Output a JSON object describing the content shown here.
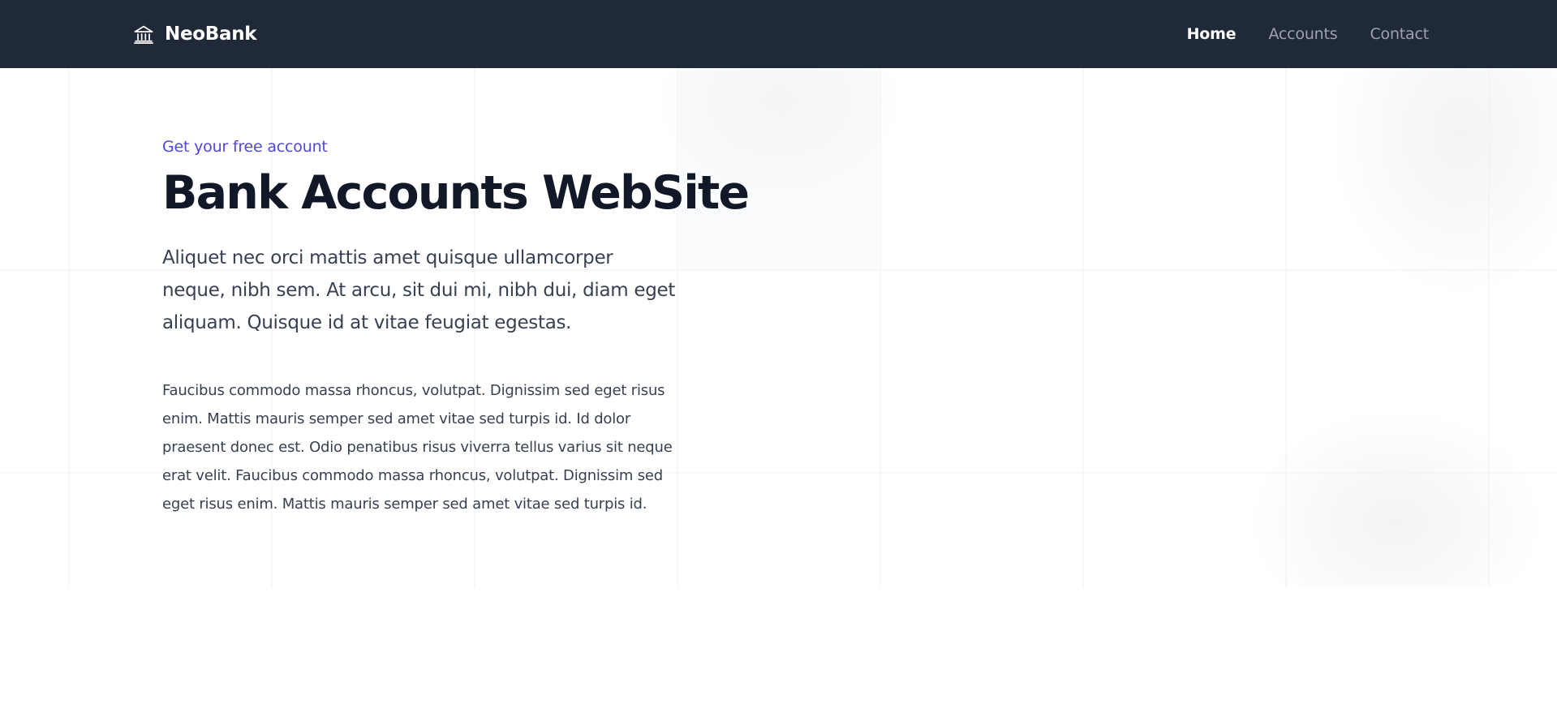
{
  "navbar": {
    "brand_icon": "bank-icon",
    "brand_name": "NeoBank",
    "links": [
      {
        "label": "Home",
        "active": true
      },
      {
        "label": "Accounts",
        "active": false
      },
      {
        "label": "Contact",
        "active": false
      }
    ]
  },
  "hero": {
    "eyebrow": "Get your free account",
    "title": "Bank Accounts WebSite",
    "lead": "Aliquet nec orci mattis amet quisque ullamcorper neque, nibh sem. At arcu, sit dui mi, nibh dui, diam eget aliquam. Quisque id at vitae feugiat egestas.",
    "body": "Faucibus commodo massa rhoncus, volutpat. Dignissim sed eget risus enim. Mattis mauris semper sed amet vitae sed turpis id. Id dolor praesent donec est. Odio penatibus risus viverra tellus varius sit neque erat velit. Faucibus commodo massa rhoncus, volutpat. Dignissim sed eget risus enim. Mattis mauris semper sed amet vitae sed turpis id."
  },
  "colors": {
    "navbar_bg": "#1f2937",
    "accent": "#4f46e5",
    "heading": "#111827",
    "text": "#374151",
    "nav_inactive": "#9ca3af"
  }
}
